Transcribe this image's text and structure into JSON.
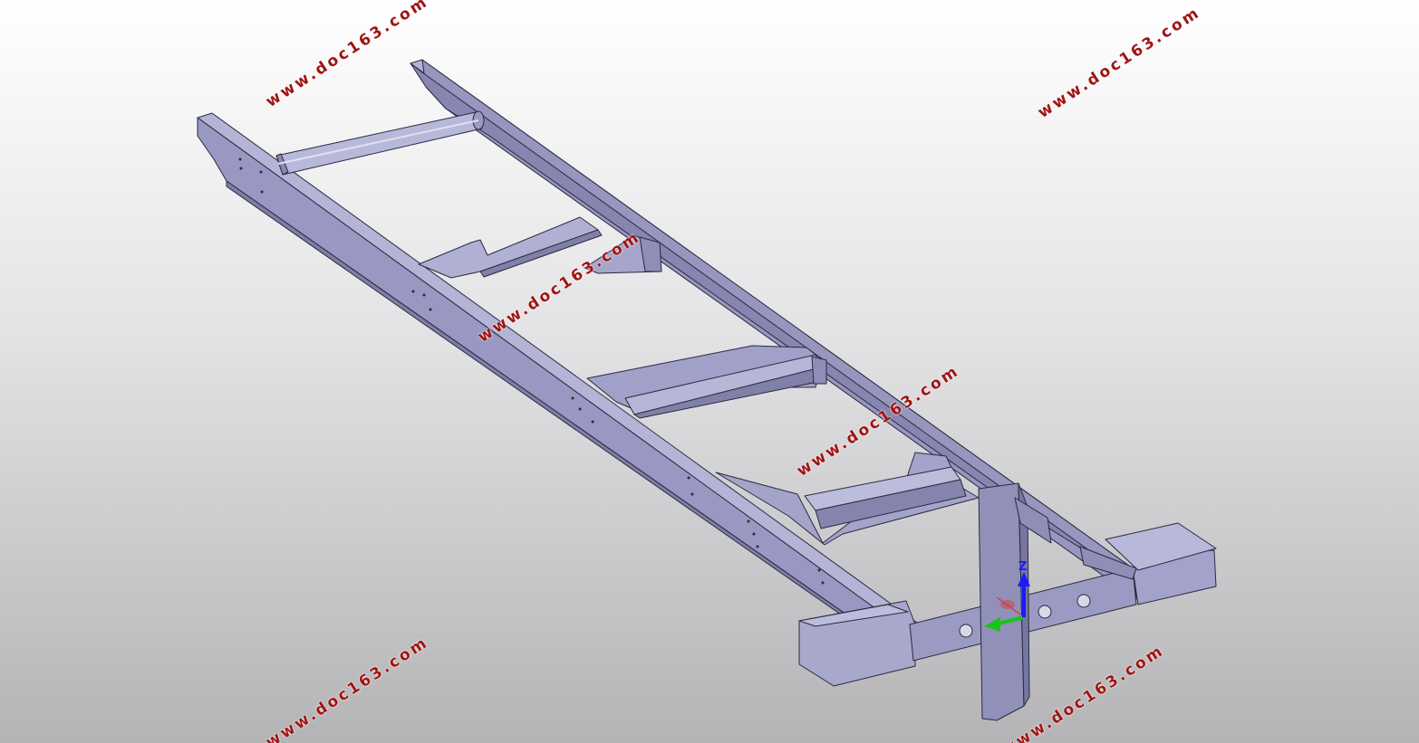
{
  "watermarks": [
    "www.doc163.com",
    "www.doc163.com",
    "www.doc163.com",
    "www.doc163.com",
    "www.doc163.com",
    "www.doc163.com"
  ],
  "triad": {
    "z_label": "Z",
    "colors": {
      "z": "#1a1aff",
      "y": "#19c419",
      "x": "#d23c3c"
    }
  },
  "model": {
    "face_light": "#a8a8cc",
    "face_mid": "#9696be",
    "face_dark": "#7e7ea6",
    "edge": "#2a2a40",
    "background_top": "#ffffff",
    "background_bottom": "#b4b4b6"
  }
}
